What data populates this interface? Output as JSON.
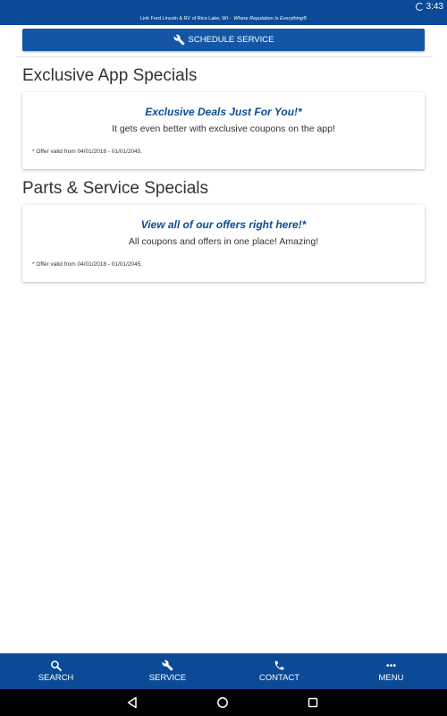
{
  "status_bar": {
    "time": "3:43",
    "loading_icon": "spinner-icon"
  },
  "dealer": {
    "name": "Link Ford Lincoln & RV of Rice Lake, WI -",
    "tagline": "Where Reputation Is Everything®"
  },
  "schedule_button": {
    "label": "SCHEDULE SERVICE",
    "icon": "wrench-icon"
  },
  "sections": [
    {
      "title": "Exclusive App Specials",
      "card": {
        "headline": "Exclusive Deals Just For You!*",
        "description": "It gets even better with exclusive coupons on the app!",
        "note": "* Offer valid from 04/01/2018 - 01/01/2045."
      }
    },
    {
      "title": "Parts & Service Specials",
      "card": {
        "headline": "View all of our offers right here!*",
        "description": "All coupons and offers in one place! Amazing!",
        "note": "* Offer valid from 04/01/2018 - 01/01/2045."
      }
    }
  ],
  "bottom_nav": [
    {
      "label": "SEARCH",
      "icon": "search-icon"
    },
    {
      "label": "SERVICE",
      "icon": "wrench-icon"
    },
    {
      "label": "CONTACT",
      "icon": "phone-icon"
    },
    {
      "label": "MENU",
      "icon": "more-dots-icon"
    }
  ],
  "system_nav": {
    "back_icon": "back-triangle-icon",
    "home_icon": "home-circle-icon",
    "recents_icon": "recents-square-icon"
  },
  "colors": {
    "brand_blue": "#0a4a96",
    "button_blue": "#1456a6",
    "headline_blue": "#0d4c93",
    "text": "#333333"
  }
}
